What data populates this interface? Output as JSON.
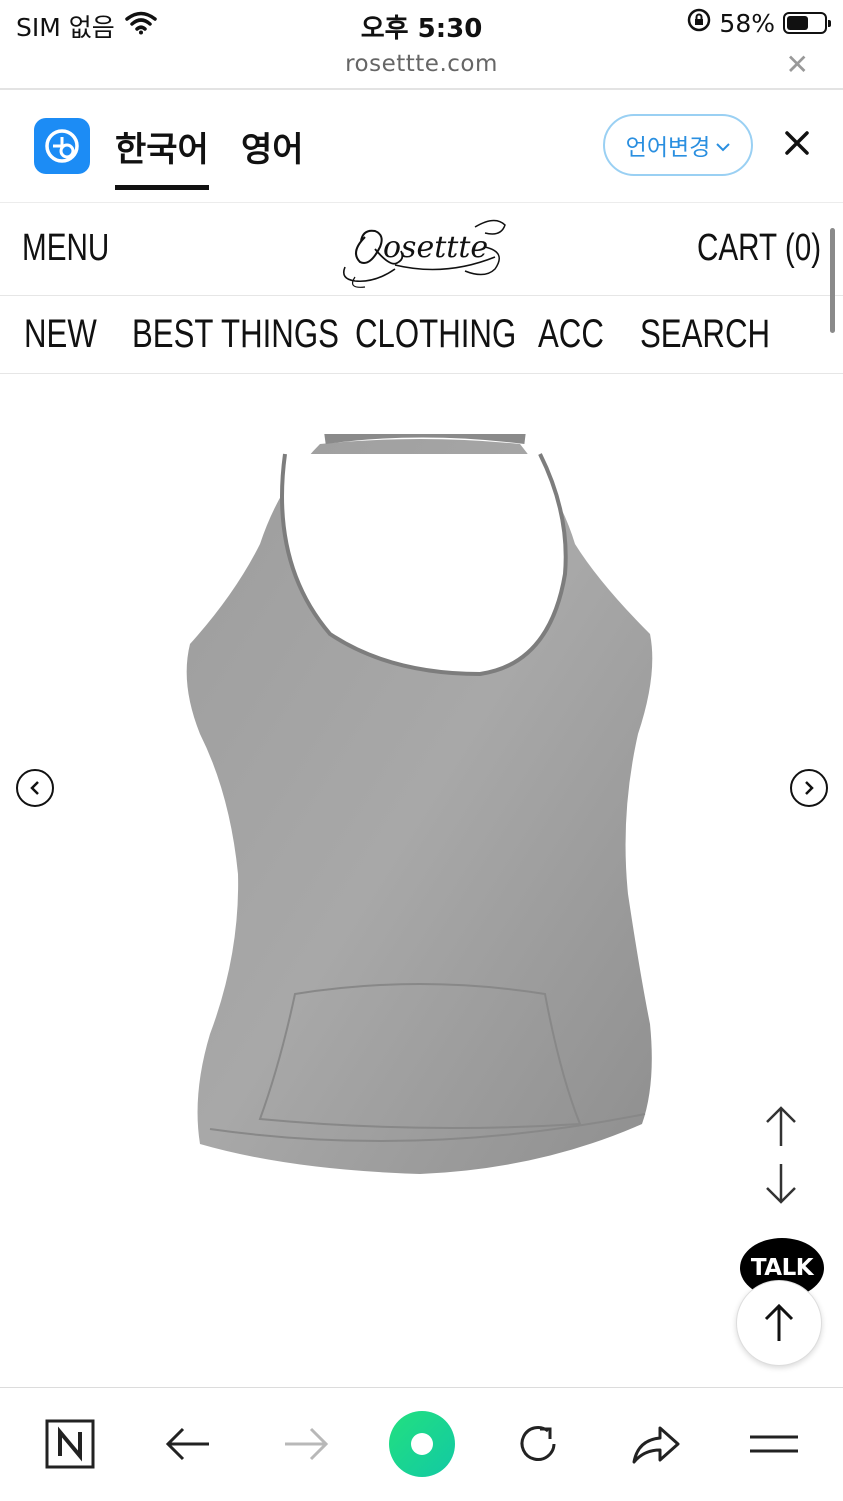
{
  "status_bar": {
    "carrier": "SIM 없음",
    "time": "오후 5:30",
    "battery": "58%",
    "battery_level": 0.58
  },
  "url_bar": {
    "url": "rosettte.com",
    "close_icon": "close-icon"
  },
  "translate_bar": {
    "languages": [
      "한국어",
      "영어"
    ],
    "active_language": "한국어",
    "change_button": "언어변경",
    "accent_color": "#2a8fe0"
  },
  "header": {
    "menu": "MENU",
    "cart": "CART (0)"
  },
  "nav": {
    "items": [
      "NEW",
      "BEST THINGS",
      "CLOTHING",
      "ACC",
      "SEARCH"
    ]
  },
  "floating": {
    "talk": "TALK"
  },
  "toolbar": {
    "icons": [
      "naver-icon",
      "back-icon",
      "forward-icon",
      "green-dot-icon",
      "reload-icon",
      "share-icon",
      "hamburger-icon"
    ]
  }
}
